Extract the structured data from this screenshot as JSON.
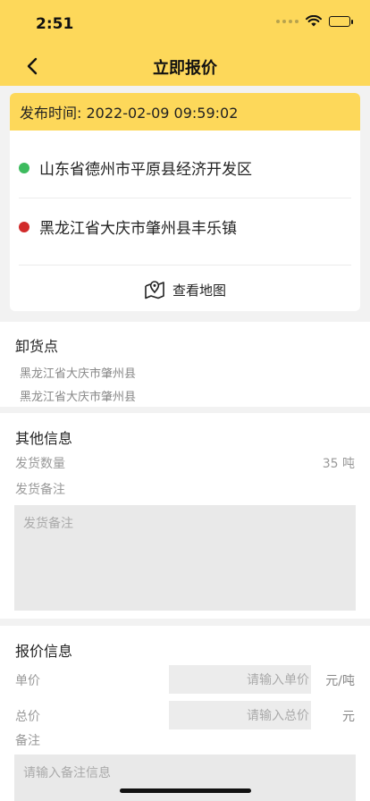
{
  "status_bar": {
    "time": "2:51"
  },
  "nav": {
    "title": "立即报价"
  },
  "route": {
    "publish_time": "发布时间: 2022-02-09 09:59:02",
    "origin": "山东省德州市平原县经济开发区",
    "destination": "黑龙江省大庆市肇州县丰乐镇",
    "map_label": "查看地图",
    "origin_color": "#3dbb5e",
    "destination_color": "#d12b2b"
  },
  "unload": {
    "title": "卸货点",
    "addresses": [
      "黑龙江省大庆市肇州县",
      "黑龙江省大庆市肇州县"
    ]
  },
  "other": {
    "title": "其他信息",
    "quantity_label": "发货数量",
    "quantity_value": "35 吨",
    "remark_label": "发货备注",
    "remark_placeholder": "发货备注"
  },
  "quote": {
    "title": "报价信息",
    "unit_price_label": "单价",
    "unit_price_placeholder": "请输入单价",
    "unit_price_unit": "元/吨",
    "total_price_label": "总价",
    "total_price_placeholder": "请输入总价",
    "total_price_unit": "元",
    "remark_label": "备注",
    "remark_placeholder": "请输入备注信息"
  },
  "colors": {
    "accent": "#fdd85a"
  }
}
